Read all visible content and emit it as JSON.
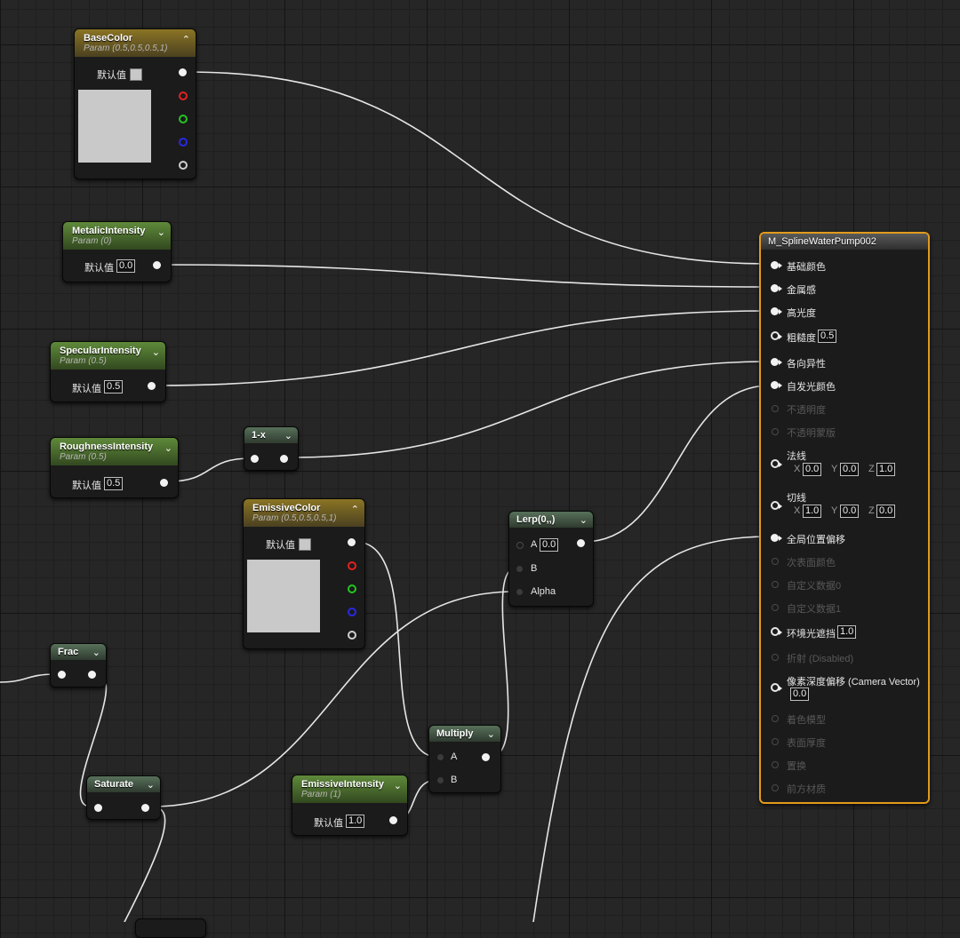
{
  "default_label": "默认值",
  "nodes": {
    "basecolor": {
      "title": "BaseColor",
      "subtitle": "Param (0.5,0.5,0.5,1)"
    },
    "metalic": {
      "title": "MetalicIntensity",
      "subtitle": "Param (0)",
      "value": "0.0"
    },
    "specular": {
      "title": "SpecularIntensity",
      "subtitle": "Param (0.5)",
      "value": "0.5"
    },
    "roughness": {
      "title": "RoughnessIntensity",
      "subtitle": "Param (0.5)",
      "value": "0.5"
    },
    "oneminus": {
      "title": "1-x"
    },
    "emissivecolor": {
      "title": "EmissiveColor",
      "subtitle": "Param (0.5,0.5,0.5,1)"
    },
    "lerp": {
      "title": "Lerp(0,,)",
      "a_label": "A",
      "a_value": "0.0",
      "b_label": "B",
      "alpha_label": "Alpha"
    },
    "frac": {
      "title": "Frac"
    },
    "saturate": {
      "title": "Saturate"
    },
    "multiply": {
      "title": "Multiply",
      "a_label": "A",
      "b_label": "B"
    },
    "emissiveintensity": {
      "title": "EmissiveIntensity",
      "subtitle": "Param (1)",
      "value": "1.0"
    }
  },
  "material": {
    "title": "M_SplineWaterPump002",
    "base_color": "基础颜色",
    "metallic": "金属感",
    "specular": "高光度",
    "roughness": "粗糙度",
    "roughness_value": "0.5",
    "anisotropy": "各向异性",
    "emissive": "自发光颜色",
    "opacity": "不透明度",
    "opacity_mask": "不透明蒙版",
    "normal": "法线",
    "normal_x_label": "X",
    "normal_x": "0.0",
    "normal_y_label": "Y",
    "normal_y": "0.0",
    "normal_z_label": "Z",
    "normal_z": "1.0",
    "tangent": "切线",
    "tangent_x_label": "X",
    "tangent_x": "1.0",
    "tangent_y_label": "Y",
    "tangent_y": "0.0",
    "tangent_z_label": "Z",
    "tangent_z": "0.0",
    "wpo": "全局位置偏移",
    "subsurface": "次表面颜色",
    "custom0": "自定义数据0",
    "custom1": "自定义数据1",
    "ao": "环境光遮挡",
    "ao_value": "1.0",
    "refraction": "折射 (Disabled)",
    "pdo": "像素深度偏移 (Camera Vector)",
    "pdo_value": "0.0",
    "shading_model": "着色模型",
    "thickness": "表面厚度",
    "displacement": "置换",
    "front_material": "前方材质"
  },
  "colors": {
    "wire": "#e8e8e8",
    "material_border": "#e29a1c",
    "param_gold": "#8a7424",
    "param_green": "#5f8a3a"
  }
}
